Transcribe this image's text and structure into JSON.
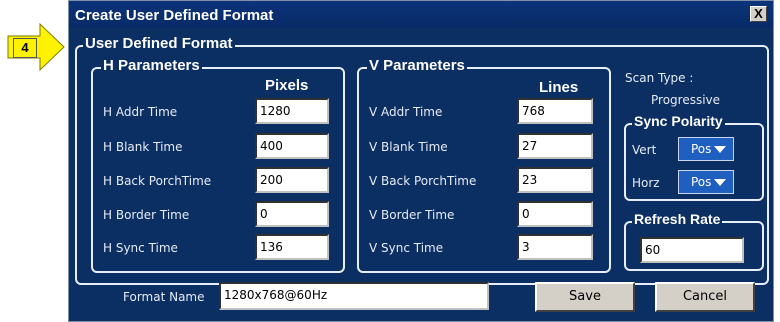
{
  "callout": {
    "number": "4"
  },
  "dialog": {
    "title": "Create User Defined Format",
    "close_label": "X",
    "group_title": "User Defined Format",
    "h_params": {
      "title": "H Parameters",
      "column_header": "Pixels",
      "rows": [
        {
          "label": "H Addr Time",
          "value": "1280"
        },
        {
          "label": "H Blank Time",
          "value": "400"
        },
        {
          "label": "H Back PorchTime",
          "value": "200"
        },
        {
          "label": "H Border Time",
          "value": "0"
        },
        {
          "label": "H Sync Time",
          "value": "136"
        }
      ]
    },
    "v_params": {
      "title": "V Parameters",
      "column_header": "Lines",
      "rows": [
        {
          "label": "V Addr Time",
          "value": "768"
        },
        {
          "label": "V Blank Time",
          "value": "27"
        },
        {
          "label": "V Back PorchTime",
          "value": "23"
        },
        {
          "label": "V Border Time",
          "value": "0"
        },
        {
          "label": "V Sync Time",
          "value": "3"
        }
      ]
    },
    "scan_type": {
      "label": "Scan Type :",
      "value": "Progressive"
    },
    "sync_polarity": {
      "title": "Sync Polarity",
      "vert_label": "Vert",
      "vert_value": "Pos",
      "horz_label": "Horz",
      "horz_value": "Pos"
    },
    "refresh_rate": {
      "title": "Refresh Rate",
      "value": "60"
    },
    "format_name": {
      "label": "Format Name",
      "value": "1280x768@60Hz"
    },
    "buttons": {
      "save": "Save",
      "cancel": "Cancel"
    }
  },
  "colors": {
    "dialog_bg": "#0b2e63",
    "callout_fill": "#fff200",
    "dropdown_bg": "#1f5fbf"
  }
}
